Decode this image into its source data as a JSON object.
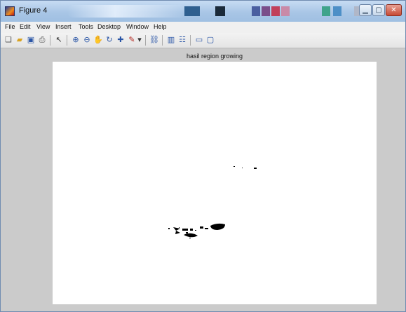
{
  "window": {
    "title": "Figure 4",
    "title_swatches": [
      "#2f5f8f",
      "#1b2a3a",
      "#4a5fa0",
      "#7a4e8a",
      "#c1405a",
      "#c98aa8",
      "#3fa38b",
      "#4d8fc7",
      "#b0b7c8"
    ]
  },
  "menu": {
    "items": [
      "File",
      "Edit",
      "View",
      "Insert",
      "Tools",
      "Desktop",
      "Window",
      "Help"
    ]
  },
  "toolbar": {
    "tools": [
      {
        "name": "new-figure-icon",
        "glyph": "❏",
        "color": "#555555"
      },
      {
        "name": "open-file-icon",
        "glyph": "▰",
        "color": "#d9a322"
      },
      {
        "name": "save-icon",
        "glyph": "▣",
        "color": "#2a55a6"
      },
      {
        "name": "print-icon",
        "glyph": "⎙",
        "color": "#444444"
      },
      {
        "name": "edit-plot-arrow-icon",
        "glyph": "↖",
        "color": "#333333"
      },
      {
        "name": "zoom-in-icon",
        "glyph": "⊕",
        "color": "#2a55a6"
      },
      {
        "name": "zoom-out-icon",
        "glyph": "⊖",
        "color": "#2a55a6"
      },
      {
        "name": "pan-hand-icon",
        "glyph": "✋",
        "color": "#7a5b2a"
      },
      {
        "name": "rotate-3d-icon",
        "glyph": "↻",
        "color": "#2a55a6"
      },
      {
        "name": "data-cursor-icon",
        "glyph": "✚",
        "color": "#2a55a6"
      },
      {
        "name": "brush-icon",
        "glyph": "✎",
        "color": "#b3261e"
      },
      {
        "name": "brush-dropdown-icon",
        "glyph": "▾",
        "color": "#333333"
      },
      {
        "name": "link-plot-icon",
        "glyph": "⛓",
        "color": "#2a55a6"
      },
      {
        "name": "insert-colorbar-icon",
        "glyph": "▥",
        "color": "#2a55a6"
      },
      {
        "name": "insert-legend-icon",
        "glyph": "☷",
        "color": "#2a55a6"
      },
      {
        "name": "hide-plot-tools-icon",
        "glyph": "▭",
        "color": "#2a55a6"
      },
      {
        "name": "show-plot-tools-icon",
        "glyph": "▢",
        "color": "#2a55a6"
      }
    ]
  },
  "axes": {
    "title": "hasil region growing"
  }
}
